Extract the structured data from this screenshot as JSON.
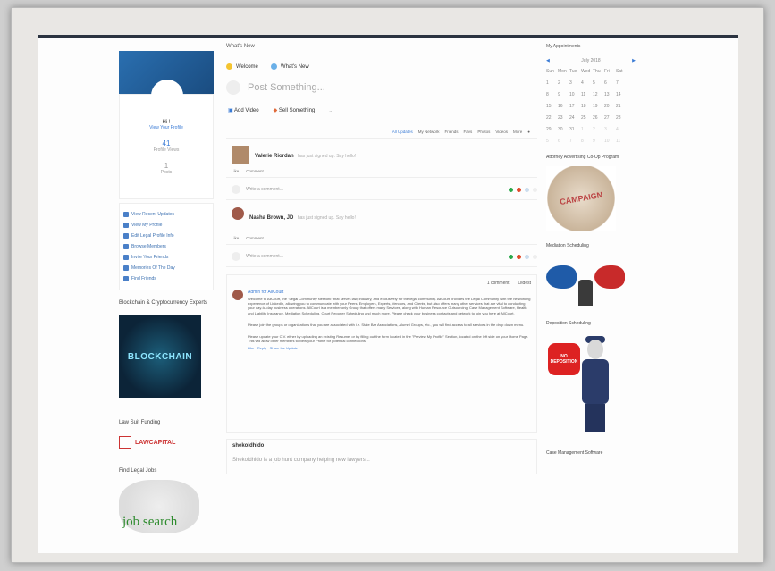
{
  "left": {
    "profile_name": "Hi !",
    "profile_link": "View Your Profile",
    "stat1_num": "41",
    "stat1_label": "Profile Views",
    "stat2_num": "1",
    "stat2_label": "Posts",
    "nav": [
      "View Recent Updates",
      "View My Profile",
      "Edit Legal Profile Info",
      "Browse Members",
      "Invite Your Friends",
      "Memories Of The Day",
      "Find Friends"
    ],
    "section1_title": "Blockchain & Cryptocurrency Experts",
    "blockchain_text": "BLOCKCHAIN",
    "section2_title": "Law Suit Funding",
    "law_logo_text": "LAWCAPITAL",
    "section3_title": "Find Legal Jobs",
    "jobsearch_text": "job search"
  },
  "middle": {
    "title": "What's New",
    "tab_welcome": "Welcome",
    "tab_whatsnew": "What's New",
    "post_placeholder": "Post Something...",
    "action_video": "Add Video",
    "action_sell": "Sell Something",
    "action_more": "...",
    "filters": [
      "All Updates",
      "My Network",
      "Friends",
      "Favs",
      "Photos",
      "Videos",
      "More"
    ],
    "feed1_name": "Valerie Riordan",
    "feed1_action": "has just signed up. Say hello!",
    "like_label": "Like",
    "comment_label": "Comment",
    "comment_placeholder": "Write a comment...",
    "feed2_name": "Nasha Brown, JD",
    "feed2_action": "has just signed up. Say hello!",
    "admin_count": "1 comment",
    "admin_filter": "Oldest",
    "admin_name": "Admin for AllCourt",
    "admin_p1": "Welcome to AllCourt, the \"Legal Community Network\" that serves law, industry, and exclusively for the legal community. AllCourt provides the Legal Community with the networking experience of LinkedIn, allowing you to communicate with your Peers, Employers, Experts, Vendors, and Clients, but also offers many other services that are vital to conducting your day-to-day business operations. AllCourt is a member only Group that offers many Services, along with Human Resource Outsourcing, Case Management Software, Health and Liability Insurance, Mediation Scheduling, Court Reporter Scheduling and much more. Please check your business contacts and network to join you here at AllCourt.",
    "admin_p2": "Please join the groups or organizations that you are associated with i.e. State Bar Associations, Alumni Groups, etc., you will find access to all services in the drop down menu.",
    "admin_p3": "Please update your C.V. either by uploading an existing Resume, or by filling out the form located in the \"Preview My Profile\" Section, located on the left side on your Home Page. This will allow other members to view your Profile for potential connections.",
    "admin_meta": "Like · Reply · Share the Update",
    "bottom_name": "shekoldhido",
    "bottom_text": "Shekoldhido is a job hunt company helping new lawyers..."
  },
  "right": {
    "title": "My Appointments",
    "month": "July 2018",
    "weekdays": [
      "Sun",
      "Mon",
      "Tue",
      "Wed",
      "Thu",
      "Fri",
      "Sat"
    ],
    "days": [
      "1",
      "2",
      "3",
      "4",
      "5",
      "6",
      "7",
      "8",
      "9",
      "10",
      "11",
      "12",
      "13",
      "14",
      "15",
      "16",
      "17",
      "18",
      "19",
      "20",
      "21",
      "22",
      "23",
      "24",
      "25",
      "26",
      "27",
      "28",
      "29",
      "30",
      "31",
      "1",
      "2",
      "3",
      "4",
      "5",
      "6",
      "7",
      "8",
      "9",
      "10",
      "11"
    ],
    "section1": "Attorney Advertising Co-Op Program",
    "campaign_text": "CAMPAIGN",
    "section2": "Mediation Scheduling",
    "section3": "Deposition Scheduling",
    "stop_text": "NO DEPOSITION",
    "section4": "Case Management Software"
  }
}
